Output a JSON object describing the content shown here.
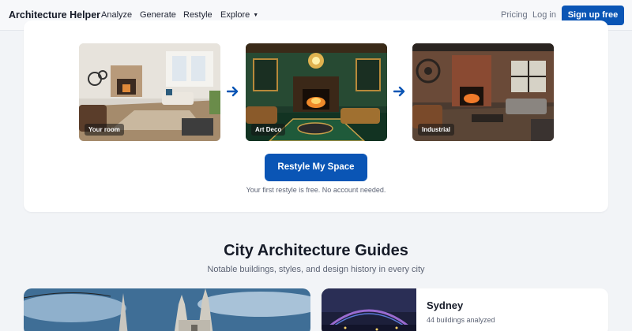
{
  "nav": {
    "brand": "Architecture Helper",
    "links": [
      "Analyze",
      "Generate",
      "Restyle",
      "Explore"
    ],
    "pricing": "Pricing",
    "login": "Log in",
    "signup": "Sign up free",
    "explore_icon": "chevron-down-icon"
  },
  "restyle": {
    "tiles": [
      {
        "label": "Your room"
      },
      {
        "label": "Art Deco"
      },
      {
        "label": "Industrial"
      }
    ],
    "arrow_icon": "arrow-right-icon",
    "cta": "Restyle My Space",
    "note": "Your first restyle is free. No account needed."
  },
  "guides": {
    "title": "City Architecture Guides",
    "subtitle": "Notable buildings, styles, and design history in every city",
    "city": {
      "name": "Sydney",
      "count": "44 buildings analyzed"
    }
  },
  "colors": {
    "accent": "#0a55b5",
    "background": "#f2f4f7"
  }
}
